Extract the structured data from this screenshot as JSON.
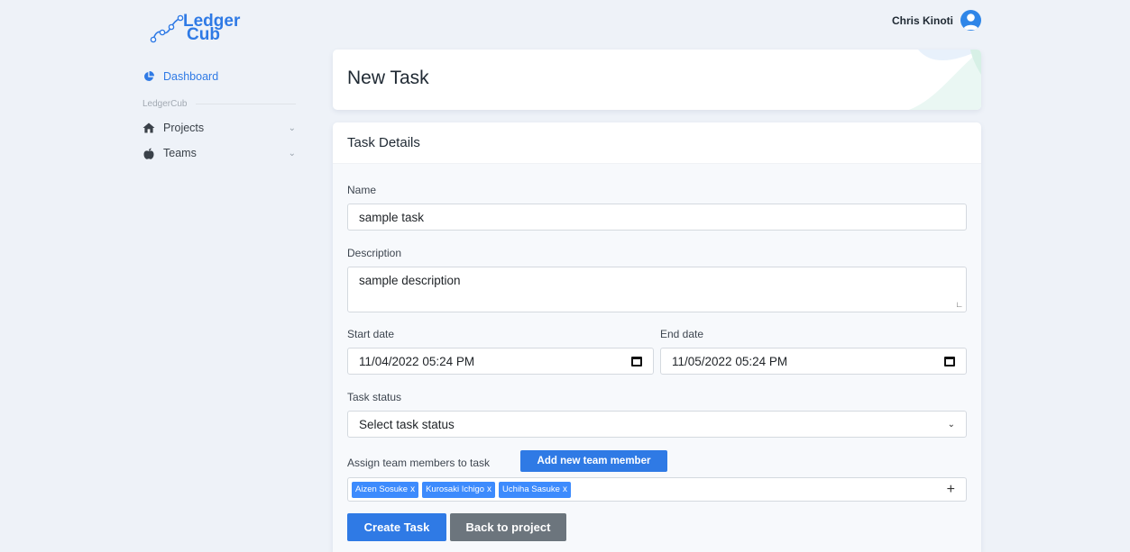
{
  "brand": {
    "line1": "Ledger",
    "line2": "Cub",
    "color": "#2f7ae5"
  },
  "user": {
    "name": "Chris Kinoti",
    "avatar_icon": "user-avatar-icon"
  },
  "sidebar": {
    "dashboard": {
      "label": "Dashboard",
      "icon": "pie-chart-icon"
    },
    "section_heading": "LedgerCub",
    "items": [
      {
        "label": "Projects",
        "icon": "home-icon"
      },
      {
        "label": "Teams",
        "icon": "apple-icon"
      }
    ]
  },
  "header": {
    "title": "New Task"
  },
  "form": {
    "card_title": "Task Details",
    "name_label": "Name",
    "name_value": "sample task",
    "description_label": "Description",
    "description_value": "sample description",
    "start_label": "Start date",
    "start_value": "11/04/2022 05:24 PM",
    "end_label": "End date",
    "end_value": "11/05/2022 05:24 PM",
    "status_label": "Task status",
    "status_value": "Select task status",
    "assign_label": "Assign team members to task",
    "add_member_button": "Add new team member",
    "members": [
      "Aizen Sosuke",
      "Kurosaki Ichigo",
      "Uchiha Sasuke"
    ],
    "remove_symbol": "x",
    "add_symbol": "+",
    "create_button": "Create Task",
    "back_button": "Back to project"
  },
  "colors": {
    "accent": "#2f7ae5",
    "secondary": "#6c757d",
    "tag": "#3d8bfd",
    "background": "#eef2f8"
  }
}
